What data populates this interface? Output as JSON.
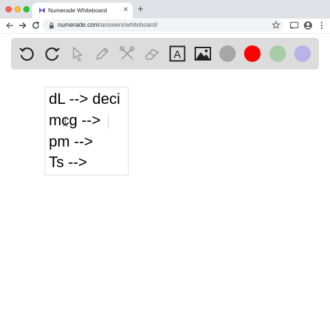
{
  "browser": {
    "tab": {
      "title": "Numerade Whiteboard",
      "favicon": "numerade-icon",
      "close_icon": "close-icon"
    },
    "new_tab_label": "+",
    "address": {
      "host": "numerade.com",
      "path": "/answers/whiteboard/"
    }
  },
  "toolbar": {
    "tools": [
      {
        "name": "undo-icon"
      },
      {
        "name": "redo-icon"
      },
      {
        "name": "pointer-icon"
      },
      {
        "name": "pencil-icon"
      },
      {
        "name": "tools-icon"
      },
      {
        "name": "eraser-icon"
      },
      {
        "name": "text-tool-icon",
        "label": "A"
      },
      {
        "name": "image-icon"
      }
    ],
    "colors": [
      "#a6a6a6",
      "#ff0000",
      "#a8cca8",
      "#b8b2e6"
    ]
  },
  "whiteboard": {
    "lines": [
      "dL --> deci",
      "mcg -->",
      "pm -->",
      "Ts -->"
    ]
  }
}
